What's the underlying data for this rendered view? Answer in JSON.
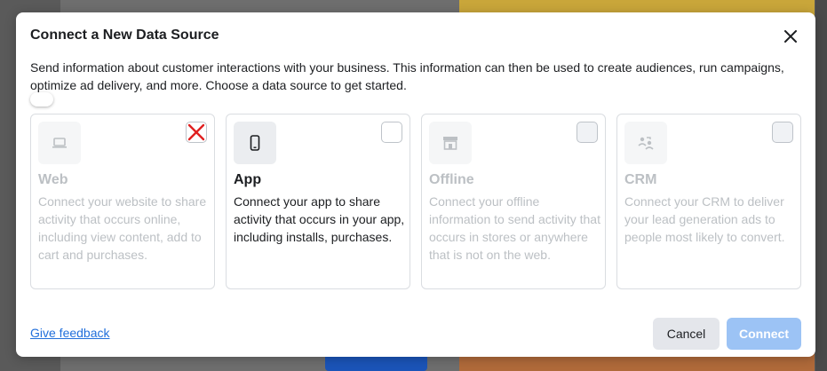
{
  "modal": {
    "title": "Connect a New Data Source",
    "description": "Send information about customer interactions with your business. This information can then be used to create audiences, run campaigns, optimize ad delivery, and more. Choose a data source to get started.",
    "close_icon": "close-icon"
  },
  "cards": [
    {
      "title": "Web",
      "description": "Connect your website to share activity that occurs online, including view content, add to cart and purchases.",
      "icon": "laptop-icon",
      "selected": false,
      "enabled": false
    },
    {
      "title": "App",
      "description": "Connect your app to share activity that occurs in your app, including installs, purchases.",
      "icon": "mobile-phone-icon",
      "selected": true,
      "enabled": true
    },
    {
      "title": "Offline",
      "description": "Connect your offline information to send activity that occurs in stores or anywhere that is not on the web.",
      "icon": "store-icon",
      "selected": false,
      "enabled": false
    },
    {
      "title": "CRM",
      "description": "Connect your CRM to deliver your lead generation ads to people most likely to convert.",
      "icon": "crm-people-icon",
      "selected": false,
      "enabled": false
    }
  ],
  "footer": {
    "feedback_label": "Give feedback",
    "cancel_label": "Cancel",
    "connect_label": "Connect"
  },
  "colors": {
    "accent": "#216fdb",
    "connect_disabled": "#9cc3f5",
    "mark_red": "#e02020"
  }
}
